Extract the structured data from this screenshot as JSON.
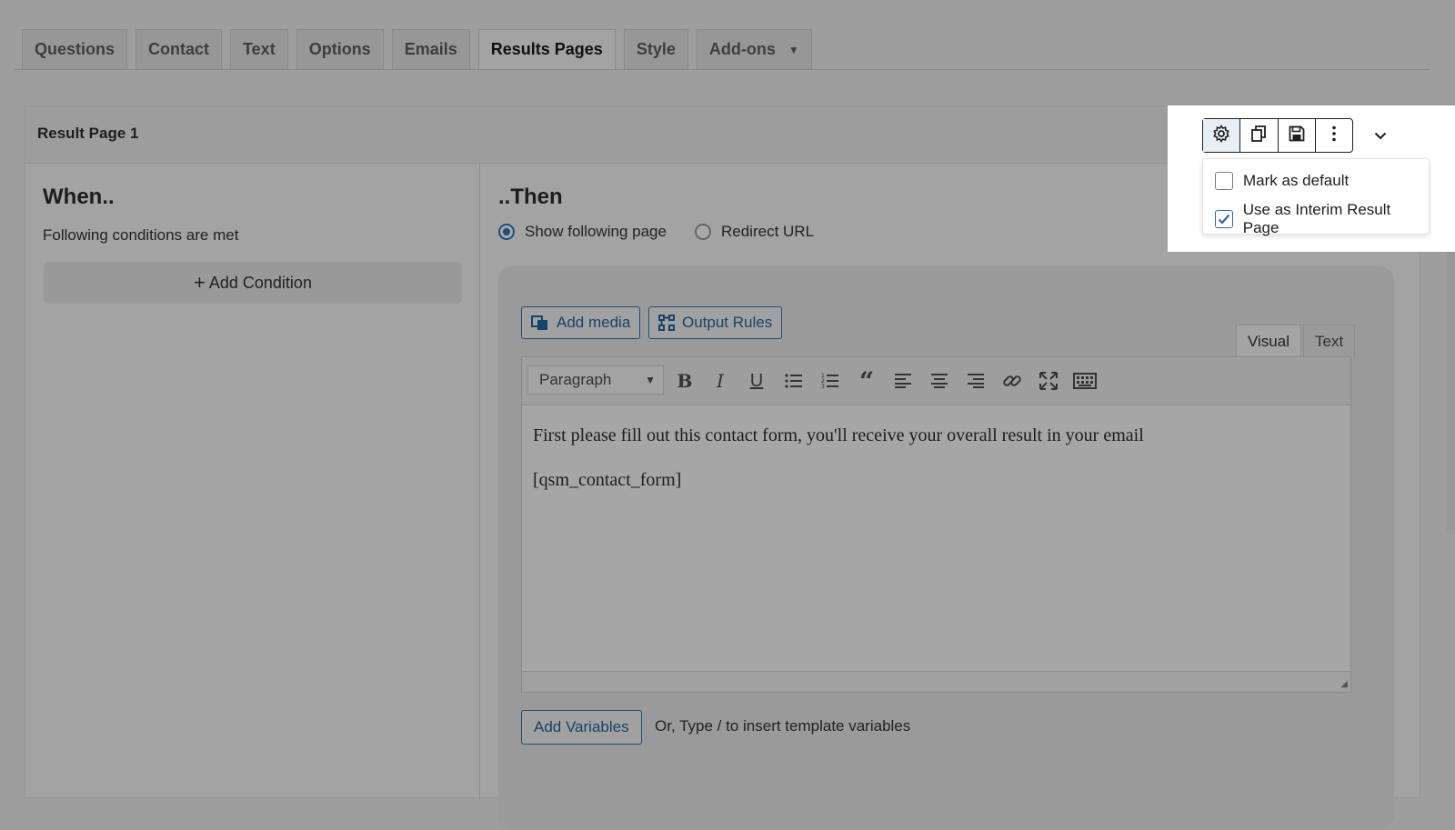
{
  "tabs": [
    {
      "label": "Questions"
    },
    {
      "label": "Contact"
    },
    {
      "label": "Text"
    },
    {
      "label": "Options"
    },
    {
      "label": "Emails"
    },
    {
      "label": "Results Pages",
      "active": true
    },
    {
      "label": "Style"
    },
    {
      "label": "Add-ons",
      "dropdown": true
    }
  ],
  "result_page": {
    "title": "Result Page 1",
    "when": {
      "title": "When..",
      "subtitle": "Following conditions are met",
      "add_condition_label": "Add Condition"
    },
    "then": {
      "title": "..Then",
      "options": [
        {
          "label": "Show following page",
          "selected": true
        },
        {
          "label": "Redirect URL",
          "selected": false
        }
      ]
    },
    "editor": {
      "add_media_label": "Add media",
      "output_rules_label": "Output Rules",
      "mode_tabs": [
        {
          "label": "Visual",
          "active": true
        },
        {
          "label": "Text",
          "active": false
        }
      ],
      "format_select": "Paragraph",
      "toolbar_icons": [
        "bold-icon",
        "italic-icon",
        "underline-icon",
        "bullet-list-icon",
        "numbered-list-icon",
        "blockquote-icon",
        "align-left-icon",
        "align-center-icon",
        "align-right-icon",
        "link-icon",
        "fullscreen-icon",
        "keyboard-icon"
      ],
      "content": [
        "First please fill out this contact form, you'll receive your overall result in your email",
        "[qsm_contact_form]"
      ]
    },
    "add_variables_label": "Add Variables",
    "variables_hint": "Or, Type / to insert template variables"
  },
  "popup": {
    "tools": [
      "gear-icon",
      "duplicate-icon",
      "save-icon",
      "more-vertical-icon"
    ],
    "collapse_icon": "chevron-down-icon",
    "options": [
      {
        "label": "Mark as default",
        "checked": false
      },
      {
        "label": "Use as Interim Result Page",
        "checked": true
      }
    ]
  },
  "colors": {
    "accent": "#1d4f7a",
    "checkbox_accent": "#3365a8"
  }
}
